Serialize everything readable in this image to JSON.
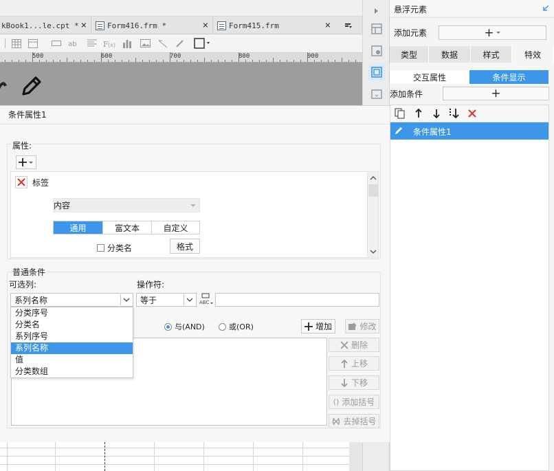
{
  "tabs": [
    {
      "label": "kBook1...le.cpt *",
      "close": "×"
    },
    {
      "label": "Form416.frm *",
      "close": "×"
    },
    {
      "label": "Form415.frm",
      "close": "×"
    }
  ],
  "ruler": {
    "marks": [
      "500",
      "600",
      "700",
      "800",
      "900"
    ]
  },
  "right_panel": {
    "title": "悬浮元素",
    "add_element_label": "添加元素",
    "add_button": "+",
    "tabs": [
      "类型",
      "数据",
      "样式",
      "特效"
    ],
    "subtabs": [
      "交互属性",
      "条件显示"
    ],
    "add_condition_label": "添加条件",
    "conditions": [
      "条件属性1"
    ]
  },
  "dialog": {
    "title": "条件属性1",
    "attributes_label": "属性:",
    "attribute_item": "标签",
    "content_select": "内容",
    "content_tabs": [
      "通用",
      "富文本",
      "自定义"
    ],
    "category_checkbox": "分类名",
    "format_button": "格式",
    "normal_condition_label": "普通条件",
    "optional_column_label": "可选列:",
    "operator_label": "操作符:",
    "column_value": "系列名称",
    "operator_value": "等于",
    "dropdown_options": [
      "分类序号",
      "分类名",
      "系列序号",
      "系列名称",
      "值",
      "分类数组"
    ],
    "dropdown_selected_index": 3,
    "and_label": "与(AND)",
    "or_label": "或(OR)",
    "add_button": "增加",
    "modify_button": "修改",
    "side_buttons": [
      "删除",
      "上移",
      "下移",
      "添加括号",
      "去掉括号"
    ]
  },
  "colors": {
    "accent": "#3d97e8",
    "danger": "#e0302a"
  }
}
